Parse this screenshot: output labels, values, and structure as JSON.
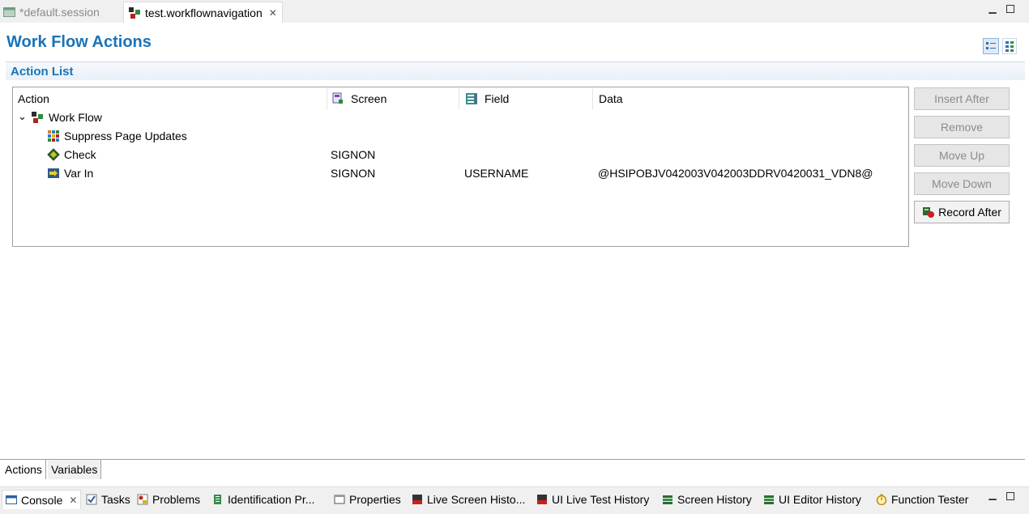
{
  "editor_tabs": [
    {
      "label": "*default.session",
      "icon": "session-icon",
      "active": false
    },
    {
      "label": "test.workflownavigation",
      "icon": "workflow-icon",
      "active": true
    }
  ],
  "page": {
    "title": "Work Flow Actions",
    "section_title": "Action List"
  },
  "table": {
    "columns": [
      {
        "label": "Action",
        "icon": ""
      },
      {
        "label": "Screen",
        "icon": "screen-icon"
      },
      {
        "label": "Field",
        "icon": "field-icon"
      },
      {
        "label": "Data",
        "icon": ""
      }
    ],
    "rows": [
      {
        "action": "Work Flow",
        "screen": "",
        "field": "",
        "data": "",
        "icon": "workflow-icon",
        "level": 0,
        "expanded": true
      },
      {
        "action": "Suppress Page Updates",
        "screen": "",
        "field": "",
        "data": "",
        "icon": "suppress-icon",
        "level": 1
      },
      {
        "action": "Check",
        "screen": "SIGNON",
        "field": "",
        "data": "",
        "icon": "check-icon",
        "level": 1
      },
      {
        "action": "Var In",
        "screen": "SIGNON",
        "field": "USERNAME",
        "data": "@HSIPOBJV042003V042003DDRV0420031_VDN8@",
        "icon": "var-in-icon",
        "level": 1
      }
    ]
  },
  "buttons": {
    "insert_after": "Insert After",
    "remove": "Remove",
    "move_up": "Move Up",
    "move_down": "Move Down",
    "record_after": "Record After"
  },
  "page_tabs": [
    {
      "label": "Actions",
      "active": true
    },
    {
      "label": "Variables",
      "active": false
    }
  ],
  "view_tabs": [
    {
      "label": "Console",
      "icon": "console-icon",
      "active": true
    },
    {
      "label": "Tasks",
      "icon": "tasks-icon"
    },
    {
      "label": "Problems",
      "icon": "problems-icon"
    },
    {
      "label": "Identification Pr...",
      "icon": "identification-icon"
    },
    {
      "label": "Properties",
      "icon": "properties-icon"
    },
    {
      "label": "Live Screen Histo...",
      "icon": "live-screen-icon"
    },
    {
      "label": "UI Live Test History",
      "icon": "live-test-icon"
    },
    {
      "label": "Screen History",
      "icon": "screen-history-icon"
    },
    {
      "label": "UI Editor History",
      "icon": "editor-history-icon"
    },
    {
      "label": "Function Tester",
      "icon": "function-tester-icon"
    }
  ],
  "colors": {
    "accent": "#1a73b8",
    "disabled_text": "#8c8c8c"
  }
}
